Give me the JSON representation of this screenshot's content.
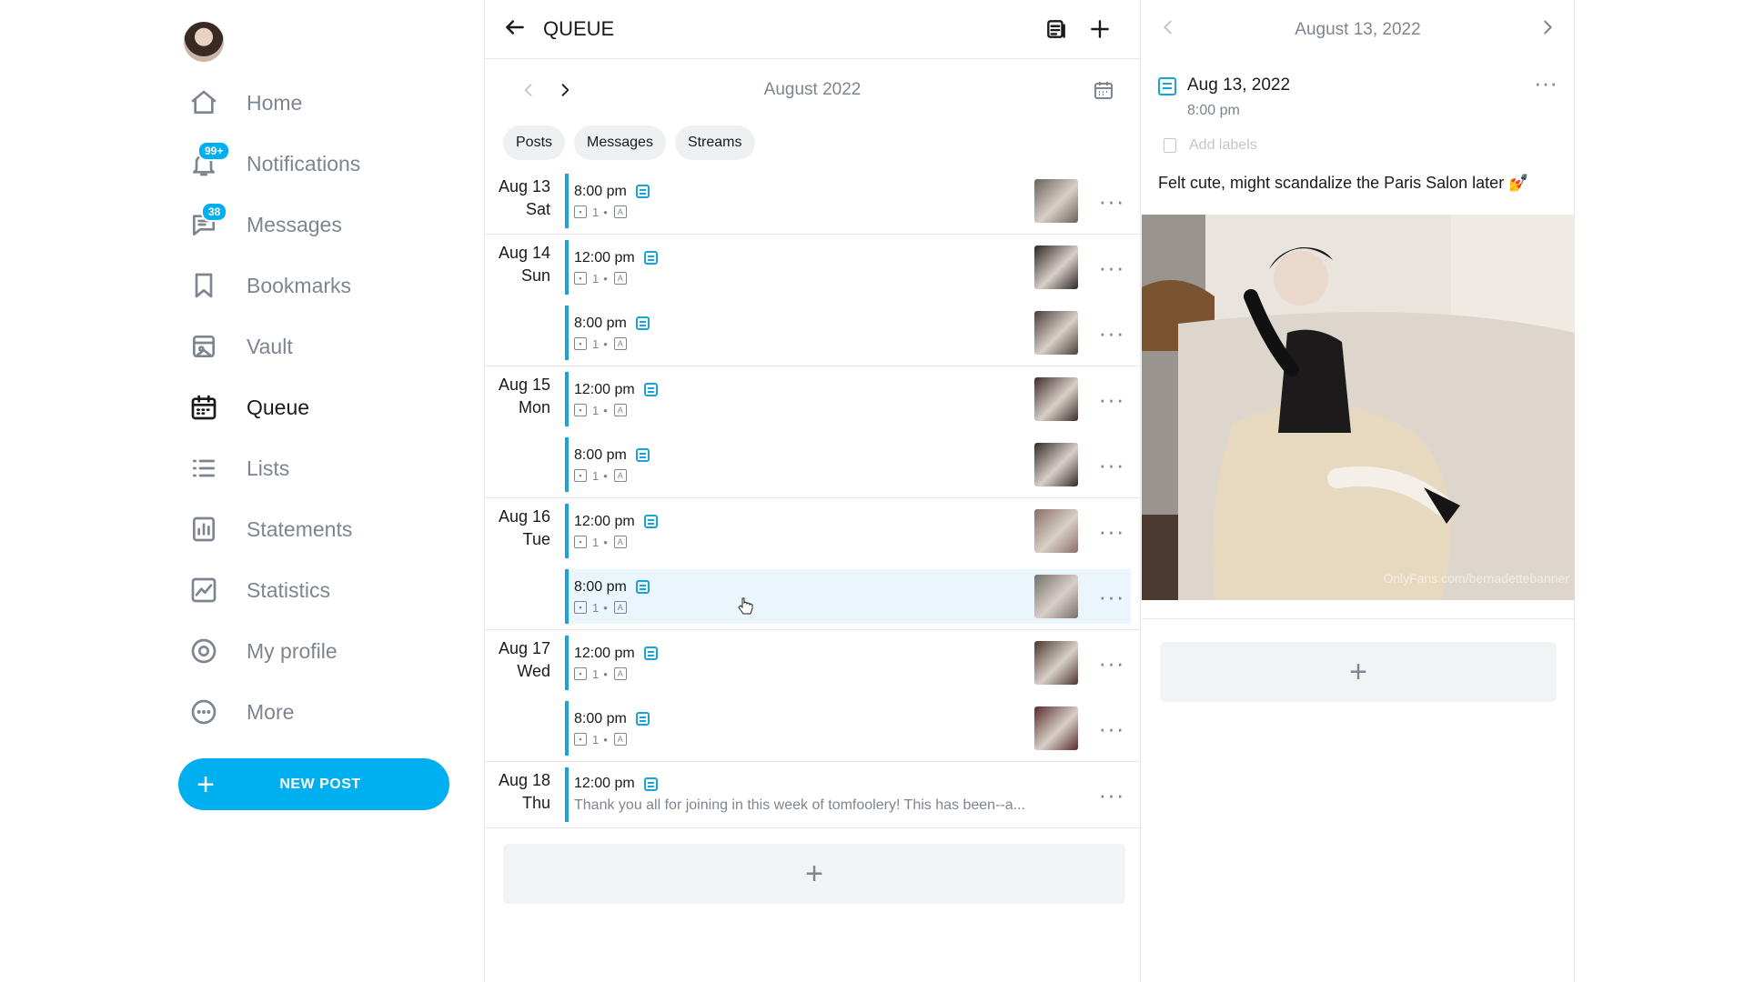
{
  "colors": {
    "accent": "#00aff0",
    "schedule_bar": "#1aa3d9",
    "muted": "#7d8590",
    "border": "#e6e9ec",
    "highlight": "#eaf6fc"
  },
  "sidebar": {
    "items": [
      {
        "label": "Home",
        "icon": "home-icon",
        "active": false
      },
      {
        "label": "Notifications",
        "icon": "bell-icon",
        "badge": "99+",
        "active": false
      },
      {
        "label": "Messages",
        "icon": "message-icon",
        "badge": "38",
        "active": false
      },
      {
        "label": "Bookmarks",
        "icon": "bookmark-icon",
        "active": false
      },
      {
        "label": "Vault",
        "icon": "vault-icon",
        "active": false
      },
      {
        "label": "Queue",
        "icon": "calendar-icon",
        "active": true
      },
      {
        "label": "Lists",
        "icon": "list-icon",
        "active": false
      },
      {
        "label": "Statements",
        "icon": "statements-icon",
        "active": false
      },
      {
        "label": "Statistics",
        "icon": "statistics-icon",
        "active": false
      },
      {
        "label": "My profile",
        "icon": "profile-icon",
        "active": false
      },
      {
        "label": "More",
        "icon": "more-icon",
        "active": false
      }
    ],
    "new_post": "NEW POST"
  },
  "queue": {
    "title": "QUEUE",
    "month": "August 2022",
    "filters": [
      "Posts",
      "Messages",
      "Streams"
    ],
    "entries": [
      {
        "day": "Aug 13",
        "weekday": "Sat",
        "time": "8:00 pm",
        "media_count": "1",
        "thumb_color": "#6b625a"
      },
      {
        "day": "Aug 14",
        "weekday": "Sun",
        "time": "12:00 pm",
        "media_count": "1",
        "thumb_color": "#2c2624"
      },
      {
        "day": "",
        "weekday": "",
        "time": "8:00 pm",
        "media_count": "1",
        "thumb_color": "#4a3d38"
      },
      {
        "day": "Aug 15",
        "weekday": "Mon",
        "time": "12:00 pm",
        "media_count": "1",
        "thumb_color": "#3e2c2a"
      },
      {
        "day": "",
        "weekday": "",
        "time": "8:00 pm",
        "media_count": "1",
        "thumb_color": "#352a2a"
      },
      {
        "day": "Aug 16",
        "weekday": "Tue",
        "time": "12:00 pm",
        "media_count": "1",
        "thumb_color": "#8a6e68"
      },
      {
        "day": "",
        "weekday": "",
        "time": "8:00 pm",
        "media_count": "1",
        "thumb_color": "#77716c",
        "highlighted": true
      },
      {
        "day": "Aug 17",
        "weekday": "Wed",
        "time": "12:00 pm",
        "media_count": "1",
        "thumb_color": "#4b3530"
      },
      {
        "day": "",
        "weekday": "",
        "time": "8:00 pm",
        "media_count": "1",
        "thumb_color": "#5a2a2c"
      },
      {
        "day": "Aug 18",
        "weekday": "Thu",
        "time": "12:00 pm",
        "preview": "Thank you all for joining in this week of tomfoolery! This has been--a..."
      }
    ]
  },
  "detail": {
    "header_date": "August 13, 2022",
    "date": "Aug 13, 2022",
    "time": "8:00 pm",
    "add_labels": "Add labels",
    "caption": "Felt cute, might scandalize the Paris Salon later 💅",
    "watermark": "OnlyFans.com/bernadettebanner"
  }
}
